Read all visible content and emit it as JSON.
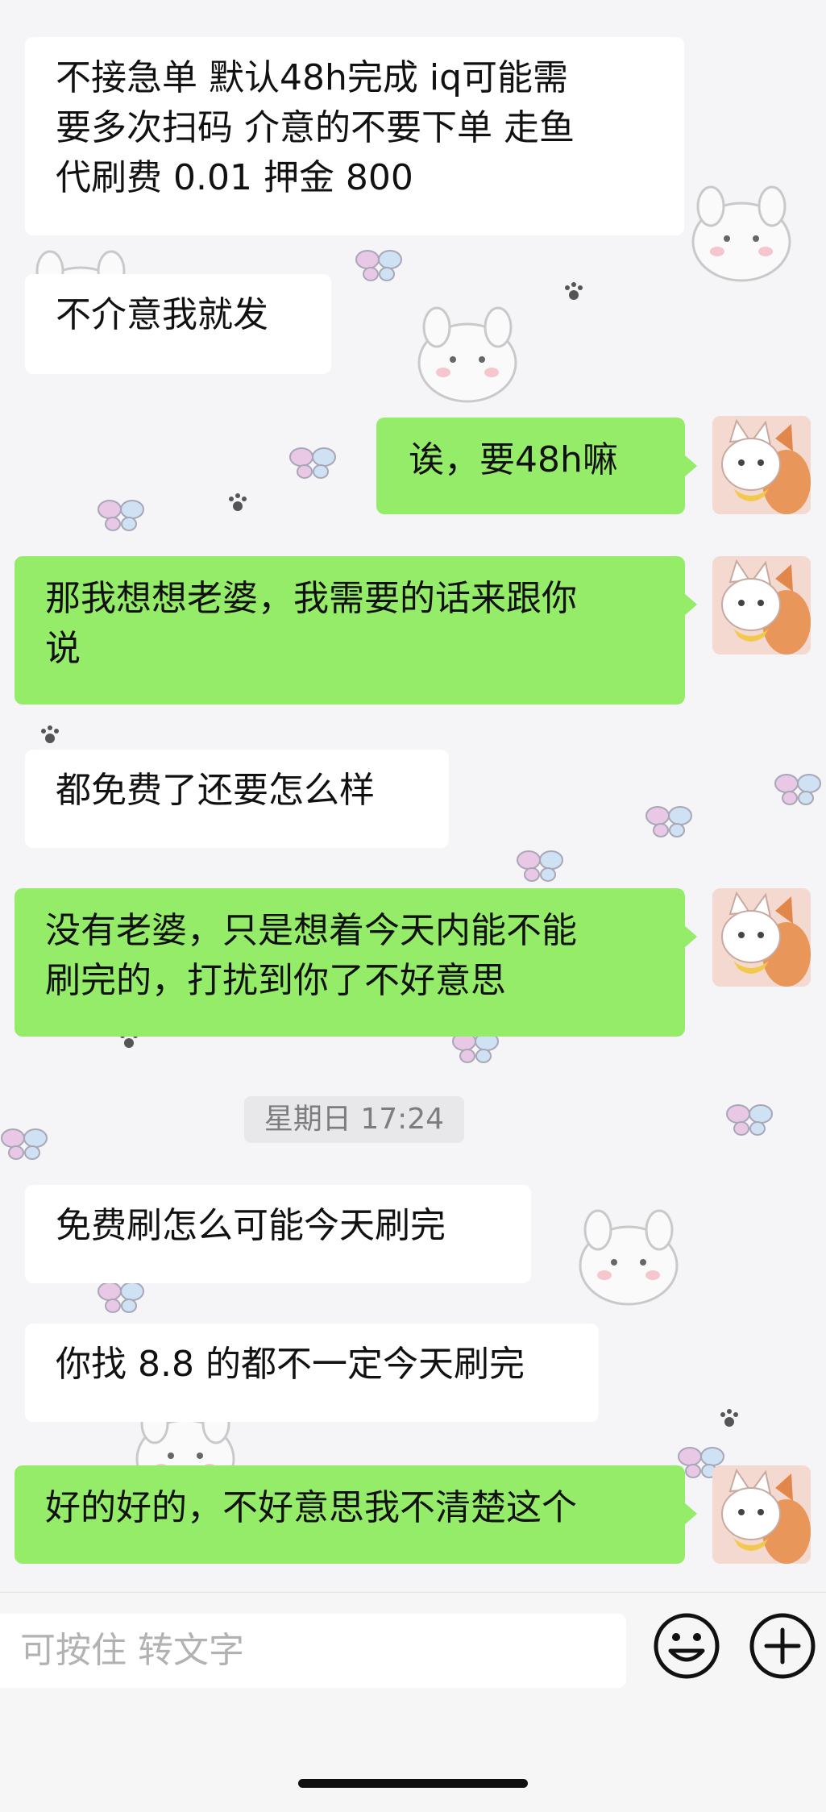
{
  "chat": {
    "messages": [
      {
        "side": "in",
        "text": "不接急单 默认48h完成 iq可能需\n要多次扫码 介意的不要下单 走鱼\n代刷费 0.01 押金 800"
      },
      {
        "side": "in",
        "text": "不介意我就发"
      },
      {
        "side": "out",
        "text": "诶，要48h嘛"
      },
      {
        "side": "out",
        "text": "那我想想老婆，我需要的话来跟你\n说"
      },
      {
        "side": "in",
        "text": "都免费了还要怎么样"
      },
      {
        "side": "out",
        "text": "没有老婆，只是想着今天内能不能\n刷完的，打扰到你了不好意思"
      },
      {
        "side": "in",
        "text": "免费刷怎么可能今天刷完"
      },
      {
        "side": "in",
        "text": "你找 8.8 的都不一定今天刷完"
      },
      {
        "side": "out",
        "text": "好的好的，不好意思我不清楚这个"
      }
    ],
    "timestamp": "星期日 17:24"
  },
  "input_bar": {
    "placeholder": "可按住 转文字",
    "emoji_icon": "emoji-icon",
    "plus_icon": "plus-icon"
  },
  "colors": {
    "outgoing_bubble": "#95ec69",
    "incoming_bubble": "#ffffff",
    "background": "#f5f4f6"
  }
}
